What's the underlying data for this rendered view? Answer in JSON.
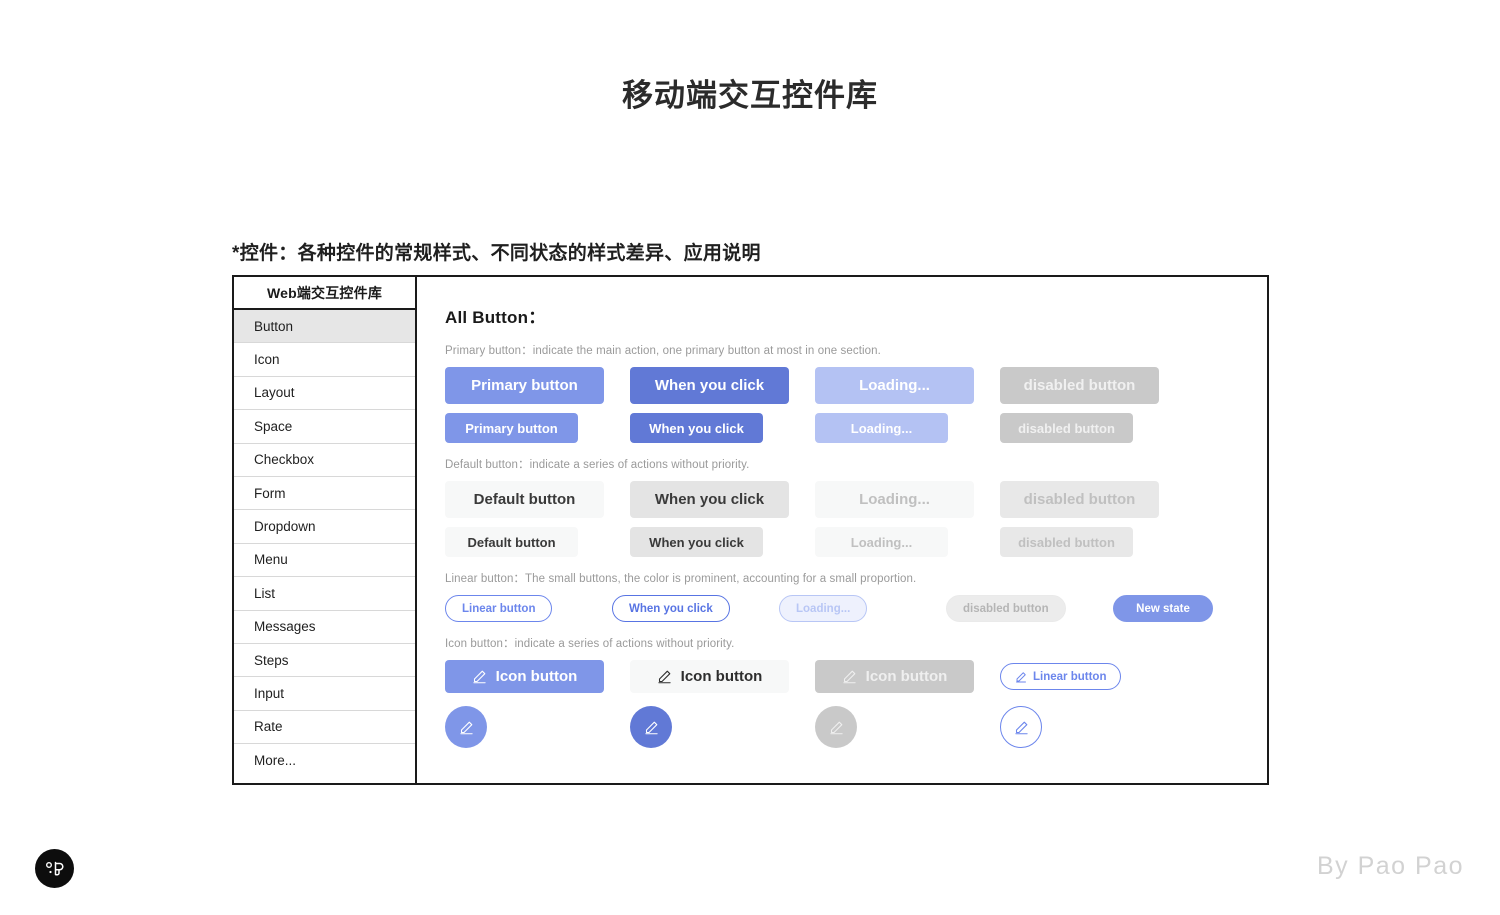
{
  "page": {
    "title": "移动端交互控件库",
    "subtitle": "*控件：各种控件的常规样式、不同状态的样式差异、应用说明",
    "signature": "By Pao Pao"
  },
  "sidebar": {
    "title": "Web端交互控件库",
    "items": [
      {
        "label": "Button",
        "active": true
      },
      {
        "label": "Icon",
        "active": false
      },
      {
        "label": "Layout",
        "active": false
      },
      {
        "label": "Space",
        "active": false
      },
      {
        "label": "Checkbox",
        "active": false
      },
      {
        "label": "Form",
        "active": false
      },
      {
        "label": "Dropdown",
        "active": false
      },
      {
        "label": "Menu",
        "active": false
      },
      {
        "label": "List",
        "active": false
      },
      {
        "label": "Messages",
        "active": false
      },
      {
        "label": "Steps",
        "active": false
      },
      {
        "label": "Input",
        "active": false
      },
      {
        "label": "Rate",
        "active": false
      },
      {
        "label": "More...",
        "active": false
      }
    ]
  },
  "content": {
    "heading": "All Button：",
    "primary": {
      "desc": "Primary button：indicate the main action, one primary button at most in one section.",
      "large": [
        "Primary button",
        "When you click",
        "Loading...",
        "disabled button"
      ],
      "small": [
        "Primary button",
        "When you click",
        "Loading...",
        "disabled button"
      ]
    },
    "default": {
      "desc": "Default button：indicate a series of actions without priority.",
      "large": [
        "Default button",
        "When you click",
        "Loading...",
        "disabled button"
      ],
      "small": [
        "Default button",
        "When you click",
        "Loading...",
        "disabled button"
      ]
    },
    "linear": {
      "desc": "Linear button：The small buttons, the color is prominent, accounting for a small proportion.",
      "items": [
        "Linear button",
        "When you click",
        "Loading...",
        "disabled button",
        "New state"
      ]
    },
    "icon": {
      "desc": "Icon button：indicate a series of actions without priority.",
      "items": [
        "Icon button",
        "Icon button",
        "Icon button",
        "Linear button"
      ],
      "glyph": "pencil-icon"
    }
  },
  "colors": {
    "primary": "#7f96e8",
    "primary_pressed": "#6179d6",
    "primary_loading": "#b4c2f3",
    "disabled": "#c9c9c9",
    "default_bg": "#f7f8f8",
    "default_pressed": "#e4e4e4",
    "linear_border": "#6c86ec"
  }
}
